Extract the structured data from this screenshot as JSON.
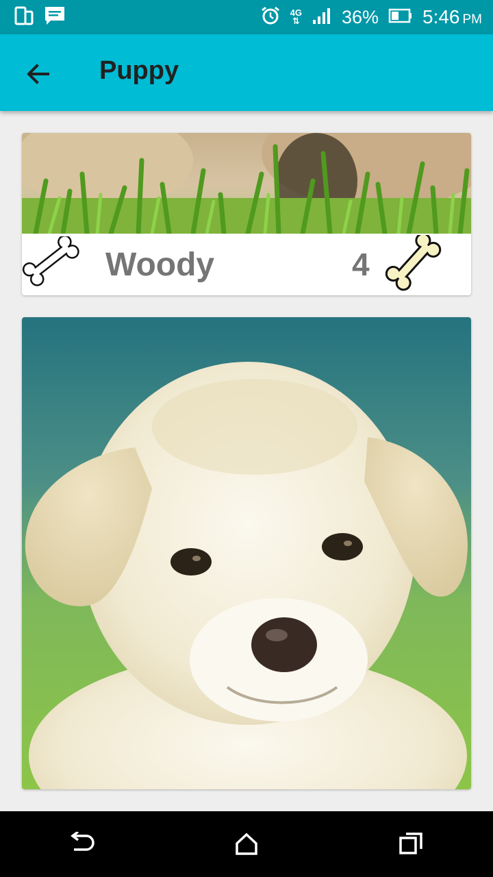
{
  "status_bar": {
    "battery_text": "36%",
    "network_text": "4G",
    "time": "5:46",
    "ampm": "PM",
    "icons": [
      "phone-tablet-icon",
      "message-icon",
      "alarm-icon",
      "network-4g-icon",
      "signal-icon",
      "battery-icon"
    ]
  },
  "app_bar": {
    "title": "Puppy",
    "back_icon": "arrow-back-icon"
  },
  "pet_card": {
    "name": "Woody",
    "count": "4",
    "left_icon": "bone-outline-icon",
    "right_icon": "bone-filled-icon"
  },
  "colors": {
    "status_bar": "#0097a7",
    "app_bar": "#00bcd4",
    "background": "#eeeeee",
    "text_gray": "#757575",
    "bone_fill": "#f7f2c4"
  },
  "nav_bar": {
    "icons": [
      "back-nav-icon",
      "home-nav-icon",
      "recents-nav-icon"
    ]
  }
}
